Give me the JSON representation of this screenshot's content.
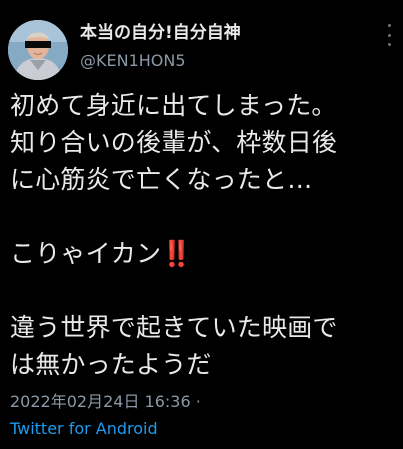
{
  "user": {
    "display_name": "本当の自分!自分自神",
    "handle": "@KEN1HON5",
    "avatar": "avatar-image"
  },
  "menu": {
    "icon": "more-options-icon"
  },
  "tweet": {
    "lines": [
      "初めて身近に出てしまった。",
      "知り合いの後輩が、枠数日後",
      "に心筋炎で亡くなったと…",
      "",
      "こりゃイカン",
      "",
      "違う世界で起きていた映画で",
      "は無かったようだ"
    ],
    "emoji": "‼️"
  },
  "meta": {
    "timestamp": "2022年02月24日 16:36 ·",
    "source": "Twitter for Android"
  },
  "colors": {
    "background": "#000000",
    "text": "#e7e9ea",
    "secondary": "#8b98a5",
    "link": "#1d9bf0",
    "emoji": "#e0245e"
  }
}
